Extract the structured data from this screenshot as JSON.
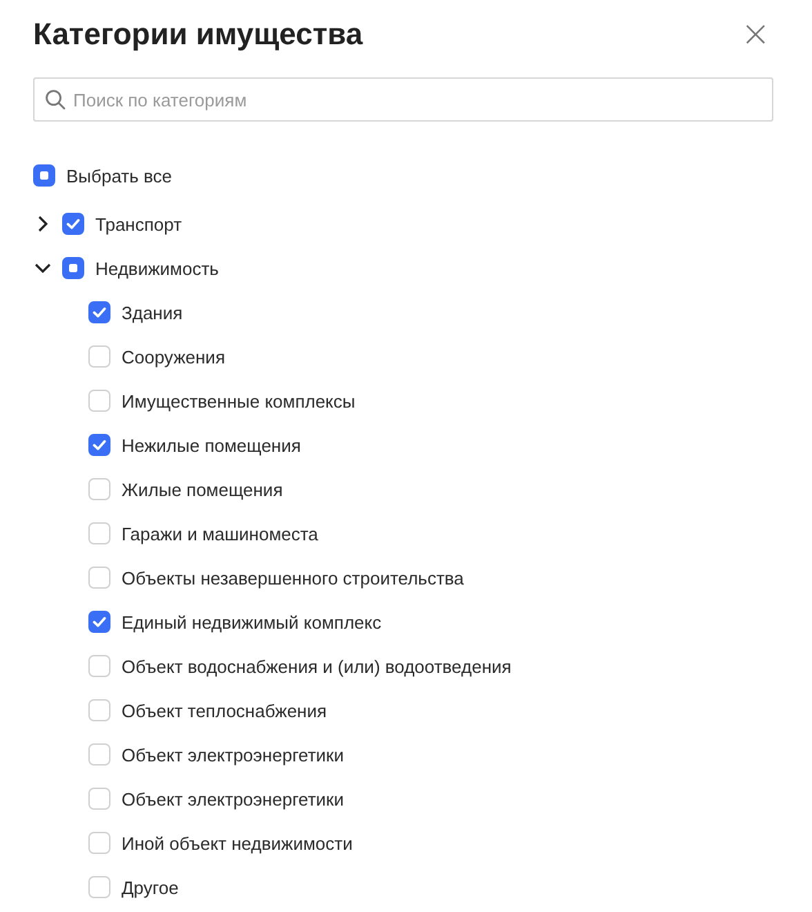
{
  "dialog": {
    "title": "Категории имущества",
    "close_icon": "×"
  },
  "search": {
    "placeholder": "Поиск по категориям"
  },
  "select_all": {
    "label": "Выбрать все",
    "checked": true,
    "indeterminate": true
  },
  "tree": [
    {
      "label": "Транспорт",
      "checked": true,
      "expanded": false
    },
    {
      "label": "Недвижимость",
      "checked": true,
      "indeterminate": true,
      "expanded": true,
      "children": [
        {
          "label": "Здания",
          "checked": true
        },
        {
          "label": "Сооружения",
          "checked": false
        },
        {
          "label": "Имущественные комплексы",
          "checked": false
        },
        {
          "label": "Нежилые помещения",
          "checked": true
        },
        {
          "label": "Жилые помещения",
          "checked": false
        },
        {
          "label": "Гаражи и машиноместа",
          "checked": false
        },
        {
          "label": "Объекты незавершенного строительства",
          "checked": false
        },
        {
          "label": "Единый недвижимый комплекс",
          "checked": true
        },
        {
          "label": "Объект водоснабжения и (или) водоотведения",
          "checked": false
        },
        {
          "label": "Объект теплоснабжения",
          "checked": false
        },
        {
          "label": "Объект электроэнергетики",
          "checked": false
        },
        {
          "label": "Объект электроэнергетики",
          "checked": false
        },
        {
          "label": "Иной объект недвижимости",
          "checked": false
        },
        {
          "label": "Другое",
          "checked": false
        }
      ]
    }
  ]
}
